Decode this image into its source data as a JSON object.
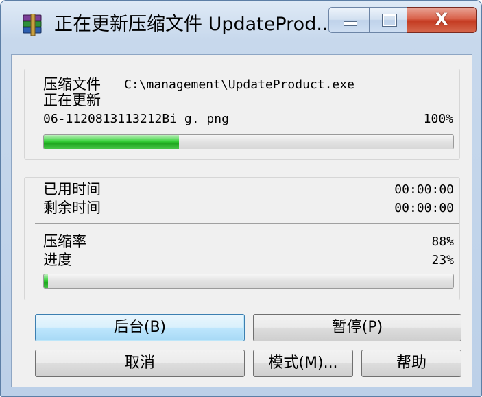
{
  "window": {
    "title": "正在更新压缩文件 UpdateProd...",
    "icon": "winrar-books-icon",
    "controls": {
      "minimize": "minimize-icon",
      "maximize": "maximize-icon",
      "close_glyph": "X"
    }
  },
  "file_group": {
    "archive_label": "压缩文件",
    "archive_path": "C:\\management\\UpdateProduct.exe",
    "status_label": "正在更新",
    "current_file": "06-1120813113212Bi g. png",
    "file_percent_text": "100%",
    "file_progress": 0.33
  },
  "stats_group": {
    "elapsed_label": "已用时间",
    "elapsed_value": "00:00:00",
    "remaining_label": "剩余时间",
    "remaining_value": "00:00:00",
    "ratio_label": "压缩率",
    "ratio_value": "88%",
    "progress_label": "进度",
    "progress_value": "23%",
    "overall_progress": 0.01
  },
  "buttons": {
    "background": "后台(B)",
    "pause": "暂停(P)",
    "cancel": "取消",
    "mode": "模式(M)...",
    "help": "帮助"
  },
  "colors": {
    "progress_green": "#26b526",
    "close_red": "#c9452c",
    "focus_blue": "#3c7fb1"
  }
}
